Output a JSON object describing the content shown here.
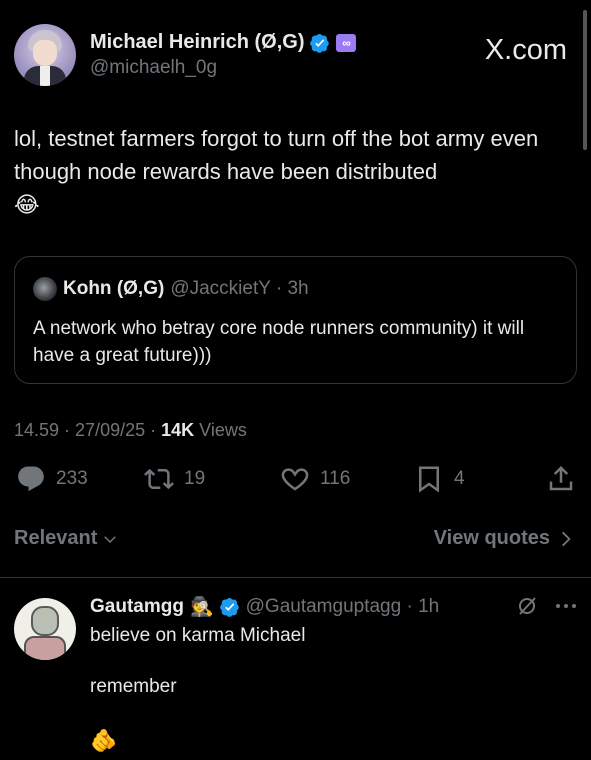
{
  "post": {
    "display_name": "Michael Heinrich (Ø,G)",
    "handle": "@michaelh_0g",
    "watermark": "X.com",
    "text": "lol, testnet farmers forgot to turn off the bot army even though node rewards have been distributed",
    "emoji": "😂",
    "badges": [
      "verified-icon",
      "infinity-badge-icon"
    ],
    "badge_infinity_text": "∞"
  },
  "quote": {
    "display_name": "Kohn (Ø,G)",
    "meta": "@JacckietY · 3h",
    "text": "A network who betray core node runners community) it will have a great future)))"
  },
  "meta": {
    "timestamp": "14.59 · 27/09/25 ·",
    "views_count": "14K",
    "views_label": "Views"
  },
  "actions": {
    "replies": "233",
    "reposts": "19",
    "likes": "116",
    "bookmarks": "4"
  },
  "filter": {
    "relevant_label": "Relevant",
    "view_quotes_label": "View quotes"
  },
  "reply": {
    "display_name": "Gautamgg",
    "name_emoji": "🕵",
    "meta": "@Gautamguptagg · 1h",
    "text": "believe on karma Michael",
    "line2": "remember",
    "emoji": "🫵"
  },
  "colors": {
    "background": "#000000",
    "text": "#e7e9ea",
    "secondary": "#71767b",
    "border": "#2f3336",
    "verified": "#1d9bf0",
    "infinity_badge": "#9b7bf2"
  }
}
